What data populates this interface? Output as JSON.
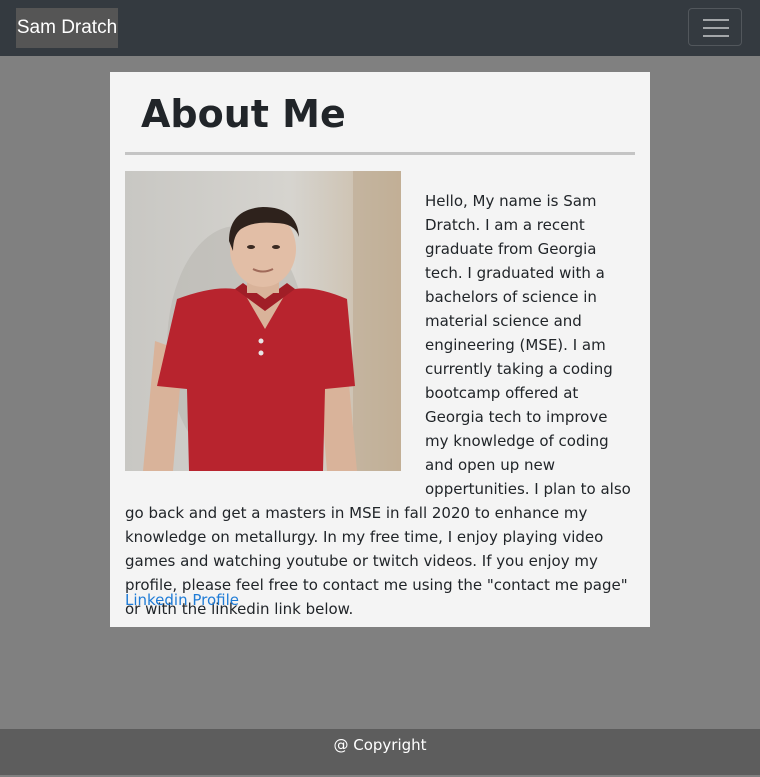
{
  "navbar": {
    "brand": "Sam Dratch",
    "toggle_icon": "hamburger-menu-icon"
  },
  "about": {
    "title": "About Me",
    "photo_alt": "portrait-photo",
    "bio": "Hello, My name is Sam Dratch. I am a recent graduate from Georgia tech. I graduated with a bachelors of science in material science and engineering (MSE). I am currently taking a coding bootcamp offered at Georgia tech to improve my knowledge of coding and open up new oppertunities. I plan to also go back and get a masters in MSE in fall 2020 to enhance my knowledge on metallurgy. In my free time, I enjoy playing video games and watching youtube or twitch videos. If you enjoy my profile, please feel free to contact me using the \"contact me page\" or with the linkedin link below.",
    "linkedin_label": "Linkedin Profile"
  },
  "footer": {
    "text": "@ Copyright"
  },
  "colors": {
    "navbar_bg": "#343a40",
    "page_bg": "#808080",
    "card_bg": "#f4f4f4",
    "link": "#1e7bd6",
    "footer_bg": "#5d5d5d"
  }
}
